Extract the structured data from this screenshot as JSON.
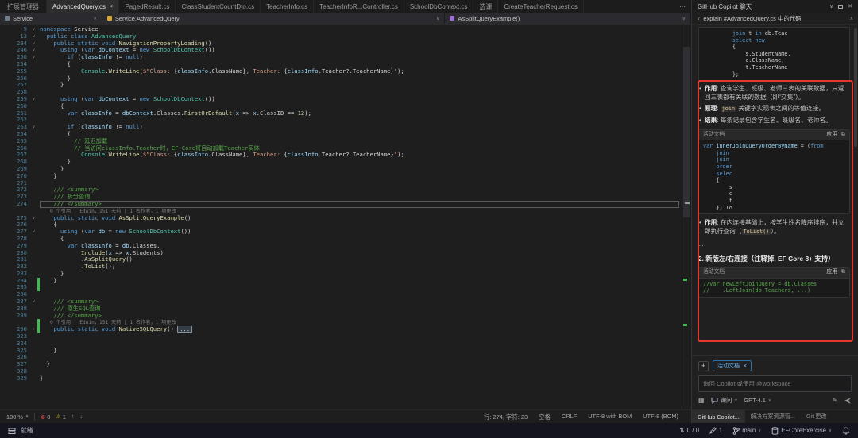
{
  "window": {
    "left_panel_label": "扩展管理器"
  },
  "tabs": {
    "items": [
      {
        "label": "AdvancedQuery.cs",
        "active": true,
        "close_icon": "✕"
      },
      {
        "label": "PagedResult.cs"
      },
      {
        "label": "ClassStudentCountDto.cs"
      },
      {
        "label": "TeacherInfo.cs"
      },
      {
        "label": "TeacherInfoR...Controller.cs"
      },
      {
        "label": "SchoolDbContext.cs"
      },
      {
        "label": "选课"
      },
      {
        "label": "CreateTeacherRequest.cs"
      }
    ]
  },
  "breadcrumb": {
    "project": "Service",
    "type": "Service.AdvancedQuery",
    "member": "AsSplitQueryExample()"
  },
  "editor": {
    "lines": [
      {
        "n": "9",
        "f": "v",
        "tk": [
          [
            "k",
            "namespace"
          ],
          [
            "p",
            " Service"
          ]
        ]
      },
      {
        "n": "13",
        "f": "v",
        "tk": [
          [
            "p",
            "  "
          ],
          [
            "k",
            "public class"
          ],
          [
            "p",
            " "
          ],
          [
            "t",
            "AdvancedQuery"
          ]
        ]
      },
      {
        "n": "234",
        "f": "v",
        "tk": [
          [
            "p",
            "    "
          ],
          [
            "k",
            "public static void"
          ],
          [
            "p",
            " "
          ],
          [
            "m",
            "NavigationPropertyLoading"
          ],
          [
            "p",
            "()"
          ]
        ]
      },
      {
        "n": "246",
        "f": "v",
        "tk": [
          [
            "p",
            "      "
          ],
          [
            "k",
            "using"
          ],
          [
            "p",
            " ("
          ],
          [
            "k",
            "var"
          ],
          [
            "p",
            " "
          ],
          [
            "v",
            "dbContext"
          ],
          [
            "p",
            " = "
          ],
          [
            "k",
            "new"
          ],
          [
            "p",
            " "
          ],
          [
            "t",
            "SchoolDbContext"
          ],
          [
            "p",
            "())"
          ]
        ]
      },
      {
        "n": "250",
        "f": "v",
        "tk": [
          [
            "p",
            "        "
          ],
          [
            "k",
            "if"
          ],
          [
            "p",
            " ("
          ],
          [
            "v",
            "classInfo"
          ],
          [
            "p",
            " != "
          ],
          [
            "k",
            "null"
          ],
          [
            "p",
            ")"
          ]
        ]
      },
      {
        "n": "254",
        "tk": [
          [
            "p",
            "        {"
          ]
        ]
      },
      {
        "n": "255",
        "tk": [
          [
            "p",
            "            "
          ],
          [
            "t",
            "Console"
          ],
          [
            "p",
            "."
          ],
          [
            "m",
            "WriteLine"
          ],
          [
            "p",
            "("
          ],
          [
            "s",
            "$\"Class: "
          ],
          [
            "p",
            "{"
          ],
          [
            "v",
            "classInfo"
          ],
          [
            "p",
            ".ClassName"
          ],
          [
            "p",
            "}"
          ],
          [
            "s",
            ", Teacher: "
          ],
          [
            "p",
            "{"
          ],
          [
            "v",
            "classInfo"
          ],
          [
            "p",
            ".Teacher?.TeacherName"
          ],
          [
            "p",
            "}"
          ],
          [
            "s",
            "\""
          ],
          [
            "p",
            ");"
          ]
        ]
      },
      {
        "n": "256",
        "tk": [
          [
            "p",
            "        }"
          ]
        ]
      },
      {
        "n": "257",
        "tk": [
          [
            "p",
            "      }"
          ]
        ]
      },
      {
        "n": "258",
        "tk": []
      },
      {
        "n": "259",
        "f": "v",
        "tk": [
          [
            "p",
            "      "
          ],
          [
            "k",
            "using"
          ],
          [
            "p",
            " ("
          ],
          [
            "k",
            "var"
          ],
          [
            "p",
            " "
          ],
          [
            "v",
            "dbContext"
          ],
          [
            "p",
            " = "
          ],
          [
            "k",
            "new"
          ],
          [
            "p",
            " "
          ],
          [
            "t",
            "SchoolDbContext"
          ],
          [
            "p",
            "())"
          ]
        ]
      },
      {
        "n": "260",
        "tk": [
          [
            "p",
            "      {"
          ]
        ]
      },
      {
        "n": "261",
        "tk": [
          [
            "p",
            "        "
          ],
          [
            "k",
            "var"
          ],
          [
            "p",
            " "
          ],
          [
            "v",
            "classInfo"
          ],
          [
            "p",
            " = "
          ],
          [
            "v",
            "dbContext"
          ],
          [
            "p",
            ".Classes."
          ],
          [
            "m",
            "FirstOrDefault"
          ],
          [
            "p",
            "("
          ],
          [
            "v",
            "x"
          ],
          [
            "p",
            " => "
          ],
          [
            "v",
            "x"
          ],
          [
            "p",
            ".ClassID == "
          ],
          [
            "n",
            "12"
          ],
          [
            "p",
            ");"
          ]
        ]
      },
      {
        "n": "262",
        "tk": []
      },
      {
        "n": "263",
        "f": "v",
        "tk": [
          [
            "p",
            "        "
          ],
          [
            "k",
            "if"
          ],
          [
            "p",
            " ("
          ],
          [
            "v",
            "classInfo"
          ],
          [
            "p",
            " != "
          ],
          [
            "k",
            "null"
          ],
          [
            "p",
            ")"
          ]
        ]
      },
      {
        "n": "264",
        "tk": [
          [
            "p",
            "        {"
          ]
        ]
      },
      {
        "n": "265",
        "tk": [
          [
            "p",
            "          "
          ],
          [
            "c",
            "// 延迟加载"
          ]
        ]
      },
      {
        "n": "266",
        "tk": [
          [
            "p",
            "          "
          ],
          [
            "c",
            "// 当访问classInfo.Teacher时，EF Core将自动加载Teacher实体"
          ]
        ]
      },
      {
        "n": "267",
        "tk": [
          [
            "p",
            "            "
          ],
          [
            "t",
            "Console"
          ],
          [
            "p",
            "."
          ],
          [
            "m",
            "WriteLine"
          ],
          [
            "p",
            "("
          ],
          [
            "s",
            "$\"Class: "
          ],
          [
            "p",
            "{"
          ],
          [
            "v",
            "classInfo"
          ],
          [
            "p",
            ".ClassName"
          ],
          [
            "p",
            "}"
          ],
          [
            "s",
            ", Teacher: "
          ],
          [
            "p",
            "{"
          ],
          [
            "v",
            "classInfo"
          ],
          [
            "p",
            ".Teacher?.TeacherName"
          ],
          [
            "p",
            "}"
          ],
          [
            "s",
            "\""
          ],
          [
            "p",
            ");"
          ]
        ]
      },
      {
        "n": "268",
        "tk": [
          [
            "p",
            "        }"
          ]
        ]
      },
      {
        "n": "269",
        "tk": [
          [
            "p",
            "      }"
          ]
        ]
      },
      {
        "n": "270",
        "tk": [
          [
            "p",
            "    }"
          ]
        ]
      },
      {
        "n": "271",
        "tk": []
      },
      {
        "n": "272",
        "tk": [
          [
            "p",
            "    "
          ],
          [
            "d",
            "/// <summary>"
          ]
        ]
      },
      {
        "n": "273",
        "tk": [
          [
            "p",
            "    "
          ],
          [
            "d",
            "/// 拆分查询"
          ]
        ]
      },
      {
        "n": "274",
        "cur": true,
        "tk": [
          [
            "p",
            "    "
          ],
          [
            "d",
            "/// </summary>"
          ]
        ]
      },
      {
        "cl": "0 个引用 | Edwin，151 天前 | 1 名作者，1 项更改"
      },
      {
        "n": "275",
        "f": "v",
        "tk": [
          [
            "p",
            "    "
          ],
          [
            "k",
            "public static void"
          ],
          [
            "p",
            " "
          ],
          [
            "m",
            "AsSplitQueryExample"
          ],
          [
            "p",
            "()"
          ]
        ]
      },
      {
        "n": "276",
        "tk": [
          [
            "p",
            "    {"
          ]
        ]
      },
      {
        "n": "277",
        "f": "v",
        "tk": [
          [
            "p",
            "      "
          ],
          [
            "k",
            "using"
          ],
          [
            "p",
            " ("
          ],
          [
            "k",
            "var"
          ],
          [
            "p",
            " "
          ],
          [
            "v",
            "db"
          ],
          [
            "p",
            " = "
          ],
          [
            "k",
            "new"
          ],
          [
            "p",
            " "
          ],
          [
            "t",
            "SchoolDbContext"
          ],
          [
            "p",
            "())"
          ]
        ]
      },
      {
        "n": "278",
        "tk": [
          [
            "p",
            "      {"
          ]
        ]
      },
      {
        "n": "279",
        "tk": [
          [
            "p",
            "        "
          ],
          [
            "k",
            "var"
          ],
          [
            "p",
            " "
          ],
          [
            "v",
            "classInfo"
          ],
          [
            "p",
            " = "
          ],
          [
            "v",
            "db"
          ],
          [
            "p",
            ".Classes."
          ]
        ]
      },
      {
        "n": "280",
        "tk": [
          [
            "p",
            "            "
          ],
          [
            "m",
            "Include"
          ],
          [
            "p",
            "("
          ],
          [
            "v",
            "x"
          ],
          [
            "p",
            " => "
          ],
          [
            "v",
            "x"
          ],
          [
            "p",
            ".Students)"
          ]
        ]
      },
      {
        "n": "281",
        "tk": [
          [
            "p",
            "            ."
          ],
          [
            "m",
            "AsSplitQuery"
          ],
          [
            "p",
            "()"
          ]
        ]
      },
      {
        "n": "282",
        "tk": [
          [
            "p",
            "            ."
          ],
          [
            "m",
            "ToList"
          ],
          [
            "p",
            "();"
          ]
        ]
      },
      {
        "n": "283",
        "tk": [
          [
            "p",
            "      }"
          ]
        ]
      },
      {
        "n": "284",
        "g": true,
        "tk": [
          [
            "p",
            "    }"
          ]
        ]
      },
      {
        "n": "285",
        "g": true,
        "tk": []
      },
      {
        "n": "286",
        "tk": []
      },
      {
        "n": "287",
        "f": "v",
        "tk": [
          [
            "p",
            "    "
          ],
          [
            "d",
            "/// <summary>"
          ]
        ]
      },
      {
        "n": "288",
        "tk": [
          [
            "p",
            "    "
          ],
          [
            "d",
            "/// 原生SQL查询"
          ]
        ]
      },
      {
        "n": "289",
        "tk": [
          [
            "p",
            "    "
          ],
          [
            "d",
            "/// </summary>"
          ]
        ]
      },
      {
        "cl": "0 个引用 | Edwin，151 天前 | 1 名作者，1 项更改",
        "g": true
      },
      {
        "n": "290",
        "f": ">",
        "g": true,
        "tk": [
          [
            "p",
            "    "
          ],
          [
            "k",
            "public static void"
          ],
          [
            "p",
            " "
          ],
          [
            "m",
            "NativeSQLQuery"
          ],
          [
            "p",
            "() "
          ],
          [
            "fold",
            "..."
          ]
        ]
      },
      {
        "n": "323",
        "tk": []
      },
      {
        "n": "324",
        "tk": []
      },
      {
        "n": "325",
        "tk": [
          [
            "p",
            "    }"
          ]
        ]
      },
      {
        "n": "326",
        "tk": []
      },
      {
        "n": "327",
        "tk": [
          [
            "p",
            "  }"
          ]
        ]
      },
      {
        "n": "328",
        "tk": []
      },
      {
        "n": "329",
        "tk": [
          [
            "p",
            "}"
          ]
        ]
      }
    ]
  },
  "copilot": {
    "title": "GitHub Copilot 聊天",
    "prompt": "explain #AdvancedQuery.cs 中的代码",
    "blocks": [
      {
        "type": "code",
        "lines": [
          [
            [
              "p",
              "         "
            ],
            [
              "k",
              "join"
            ],
            [
              "p",
              " t "
            ],
            [
              "k",
              "in"
            ],
            [
              "p",
              " db.Teac"
            ]
          ],
          [
            [
              "p",
              "         "
            ],
            [
              "k",
              "select"
            ],
            [
              "p",
              " "
            ],
            [
              "k",
              "new"
            ]
          ],
          [
            [
              "p",
              "         {"
            ]
          ],
          [
            [
              "p",
              "             s.StudentName,"
            ]
          ],
          [
            [
              "p",
              "             c.ClassName,"
            ]
          ],
          [
            [
              "p",
              "             t.TeacherName"
            ]
          ],
          [
            [
              "p",
              "         };"
            ]
          ]
        ]
      },
      {
        "type": "bullets",
        "items": [
          {
            "label": "作用",
            "t1": "查询学生、班级、老师三表的关联数据，只返回三表都有关联的数据（即“交集”）。",
            "code": "",
            "t2": ""
          },
          {
            "label": "原理",
            "t1": "",
            "code": "join",
            "t2": " 关键字实现表之间的等值连接。"
          },
          {
            "label": "结果",
            "t1": "每条记录包含学生名、班级名、老师名。",
            "code": "",
            "t2": ""
          }
        ]
      },
      {
        "type": "card",
        "header": "活动文档",
        "apply": "应用",
        "lines": [
          [
            [
              "k",
              "var"
            ],
            [
              "p",
              " "
            ],
            [
              "v",
              "innerJoinQueryOrderByName"
            ],
            [
              "p",
              " = ("
            ],
            [
              "k",
              "from"
            ]
          ],
          [
            [
              "p",
              "    "
            ],
            [
              "k",
              "join"
            ]
          ],
          [
            [
              "p",
              "    "
            ],
            [
              "k",
              "join"
            ]
          ],
          [
            [
              "p",
              "    "
            ],
            [
              "k",
              "order"
            ]
          ],
          [
            [
              "p",
              "    "
            ],
            [
              "k",
              "selec"
            ]
          ],
          [
            [
              "p",
              "    {"
            ]
          ],
          [
            [
              "p",
              "        s"
            ]
          ],
          [
            [
              "p",
              "        c"
            ]
          ],
          [
            [
              "p",
              "        t"
            ]
          ],
          [
            [
              "p",
              "    }).To"
            ]
          ]
        ]
      },
      {
        "type": "bullets",
        "items": [
          {
            "label": "作用",
            "t1": "在内连接基础上，按学生姓名降序排序，并立即执行查询（",
            "code": "ToList()",
            "t2": "）。"
          }
        ]
      },
      {
        "type": "text",
        "text": "..."
      },
      {
        "type": "heading",
        "text": "2. 新版左/右连接（注释掉, EF Core 8+ 支持）"
      },
      {
        "type": "card",
        "header": "活动文档",
        "apply": "应用",
        "lines": [
          [
            [
              "c",
              "//var newLeftJoinQuery = db.Classes"
            ]
          ],
          [
            [
              "c",
              "//    .LeftJoin(db.Teachers, ...)"
            ]
          ]
        ]
      }
    ],
    "chip_label": "活动文档",
    "input_placeholder": "询问 Copilot 或使用 @workspace",
    "ask_label": "询问",
    "model": "GPT-4.1"
  },
  "panel_tabs": [
    {
      "label": "GitHub Copilot...",
      "active": true
    },
    {
      "label": "解决方案资源管..."
    },
    {
      "label": "Git 更改"
    }
  ],
  "statusline": {
    "zoom": "100 %",
    "errors": "0",
    "warnings": "1",
    "items": [
      "行: 274, 字符: 23",
      "空格",
      "CRLF",
      "UTF-8 with BOM",
      "UTF-8 (BOM)"
    ]
  },
  "statusbar": {
    "ready": "就绪",
    "sync": "0 / 0",
    "edits": "1",
    "branch": "main",
    "repo": "EFCoreExercise"
  },
  "colors": {
    "accent": "#3794ff",
    "error": "#f14c4c",
    "warning": "#cca700",
    "added": "#3fb950",
    "annotation": "#e5382c"
  }
}
